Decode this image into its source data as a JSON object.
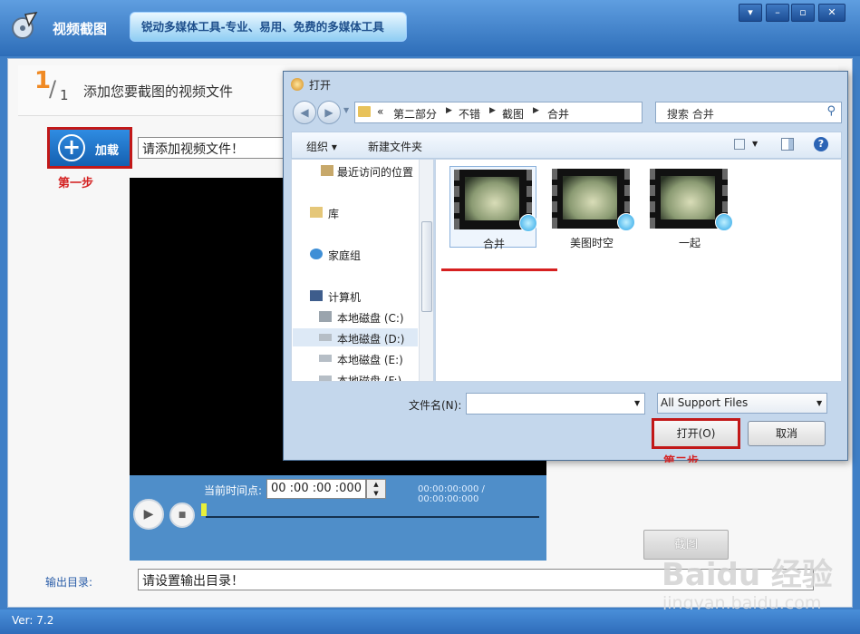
{
  "app": {
    "title": "视频截图",
    "slogan": "锐动多媒体工具-专业、易用、免费的多媒体工具",
    "window_buttons": [
      "▾",
      "–",
      "▫",
      "✕"
    ],
    "version": "Ver: 7.2"
  },
  "step": {
    "number": "1",
    "total": "1",
    "title": "添加您要截图的视频文件"
  },
  "add_button": {
    "label": "加载"
  },
  "annotations": {
    "step1": "第一步",
    "step2": "第二步"
  },
  "file_input": {
    "value": "请添加视频文件！"
  },
  "player": {
    "time_label": "当前时间点:",
    "time_value": "00 :00 :00 :000",
    "duration": "00:00:00:000 / 00:00:00:000",
    "seek_position": 0
  },
  "capture_button": {
    "label": "截图"
  },
  "output": {
    "label": "输出目录:",
    "value": "请设置输出目录！"
  },
  "watermark": {
    "logo": "Baidu 经验",
    "url": "jingyan.baidu.com"
  },
  "dialog": {
    "title": "打开",
    "breadcrumb": [
      "第二部分",
      "不错",
      "截图",
      "合并"
    ],
    "breadcrumb_prefix": "«",
    "search_placeholder": "搜索 合并",
    "toolbar": {
      "organize": "组织 ▾",
      "new_folder": "新建文件夹"
    },
    "nav_items": [
      {
        "label": "最近访问的位置",
        "icon": "recent-places-icon"
      },
      {
        "label": "库",
        "icon": "library-icon"
      },
      {
        "label": "家庭组",
        "icon": "homegroup-icon"
      },
      {
        "label": "计算机",
        "icon": "computer-icon"
      },
      {
        "label": "本地磁盘 (C:)",
        "icon": "drive-c-icon"
      },
      {
        "label": "本地磁盘 (D:)",
        "icon": "drive-icon"
      },
      {
        "label": "本地磁盘 (E:)",
        "icon": "drive-icon"
      },
      {
        "label": "本地磁盘 (F:)",
        "icon": "drive-icon"
      }
    ],
    "files": [
      {
        "name": "合并",
        "selected": true
      },
      {
        "name": "美图时空",
        "selected": false
      },
      {
        "name": "一起",
        "selected": false
      }
    ],
    "filename_label": "文件名(N):",
    "filename_value": "",
    "filetype": "All Support Files",
    "open_button": "打开(O)",
    "cancel_button": "取消"
  },
  "colors": {
    "titlebar": "#2d6db8",
    "annotation_red": "#d42323",
    "step_orange": "#f08a24"
  }
}
